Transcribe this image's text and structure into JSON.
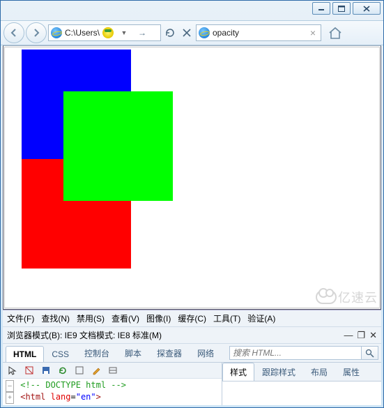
{
  "address_bar": {
    "url_text": "C:\\Users\\"
  },
  "tab": {
    "title": "opacity"
  },
  "devtools": {
    "menu": [
      "文件(F)",
      "查找(N)",
      "禁用(S)",
      "查看(V)",
      "图像(I)",
      "缓存(C)",
      "工具(T)",
      "验证(A)"
    ],
    "mode_row": "浏览器模式(B): IE9   文档模式: IE8 标准(M)",
    "tabs": [
      "HTML",
      "CSS",
      "控制台",
      "脚本",
      "探查器",
      "网络"
    ],
    "search_placeholder": "搜索 HTML...",
    "right_tabs": [
      "样式",
      "跟踪样式",
      "布局",
      "属性"
    ],
    "code": {
      "comment": "<!-- DOCTYPE html -->",
      "line2_open": "<html ",
      "line2_attr": "lang",
      "line2_eq": "=",
      "line2_val": "\"en\"",
      "line2_close": ">"
    }
  },
  "squares": {
    "blue": "#0000FF",
    "green": "#00FF00",
    "red": "#FF0000"
  },
  "watermark": "亿速云"
}
